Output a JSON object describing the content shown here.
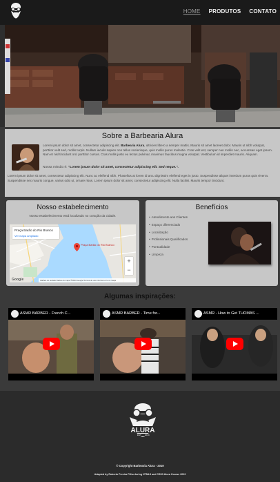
{
  "nav": {
    "home": "HOME",
    "produtos": "PRODUTOS",
    "contato": "CONTATO"
  },
  "about": {
    "title": "Sobre a Barbearia Alura",
    "text_before": "Lorem ipsum dolor sit amet, consectetur adipiscing elit. ",
    "brand": "Barbearia Alura",
    "text_after": ", ultricies libero a semper mattis. Mauris sit amet laoreet dolor. Mauris ut nibh volutpat, porttitor velit sed, mollis turpis. Nullam iaculis sapien non tellus scelerisque, quis mollis purus molestie. Cras velit est, semper nun mollis nec, accumsan eget ipsum. Nam et nisl tincidunt orci porttitor cursus. Cras mollis justo eu lectus pulvinar, maximus faucibus magna volutpat. Vestibulum id imperdiet mauris. Aliquam.",
    "mission_label": "Nossa missão é: ",
    "mission": "\"Lorem ipsum dolor sit amet, consectetur adipiscing elit. Sed neque.\".",
    "bottom": "Lorem ipsum dolor sit amet, consectetur adipiscing elit. Nunc ac eleifend nibh. Phasellus at lorem id arcu dignissim eleifend eget in justo. Suspendisse aliquet interdum purus quis viverra. Suspendisse nec mauris congue, varius odio ut, ornare risus. Lorem ipsum dolor sit amet, consectetur adipiscing elit. Nulla facilisi. Mauris tempor tincidunt."
  },
  "location": {
    "title": "Nosso estabelecimento",
    "subtitle": "Nosso estabelecimento está localizado no coração da cidade.",
    "map_place": "Praça Barão do Rio Branco",
    "map_link": "Ver mapa ampliado",
    "map_pin": "Praça Barão do Rio Branco",
    "map_footer": "Atalhos do teclado   Dados do mapa ©2024 Google   Termos de uso   Informar erro no mapa",
    "map_brand": "Google",
    "zoom_in": "+",
    "zoom_out": "−"
  },
  "benefits": {
    "title": "Benefícios",
    "items": [
      "Atendimento aos Clientes",
      "Espaço diferenciado",
      "Localização",
      "Profissionais Qualificados",
      "Pontualidade",
      "Limpeza"
    ]
  },
  "inspirations": {
    "title": "Algumas inspirações:",
    "videos": [
      {
        "title": "ASMR BARBER - French C..."
      },
      {
        "title": "ASMR BARBER - Time for..."
      },
      {
        "title": "ASMR - How to Get THOMAS ..."
      }
    ]
  },
  "footer": {
    "logo_text": "ALURA",
    "logo_est": "EST",
    "logo_year": "2019",
    "copyright": "© Copyright Barbearia Alura - 2019",
    "credits": "Adapted by Roberto Pereira Filho during HTML5 and CSS3 Alura Course 2023"
  }
}
